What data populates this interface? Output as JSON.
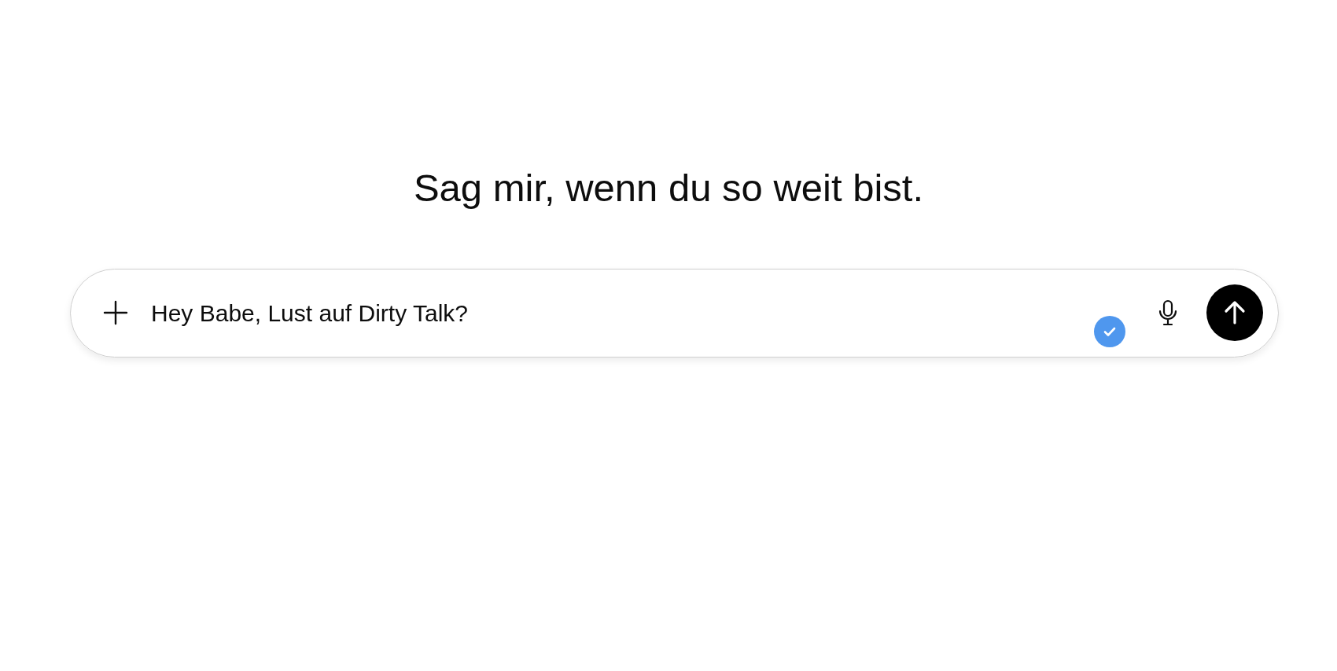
{
  "heading": "Sag mir, wenn du so weit bist.",
  "composer": {
    "value": "Hey Babe, Lust auf Dirty Talk?"
  }
}
